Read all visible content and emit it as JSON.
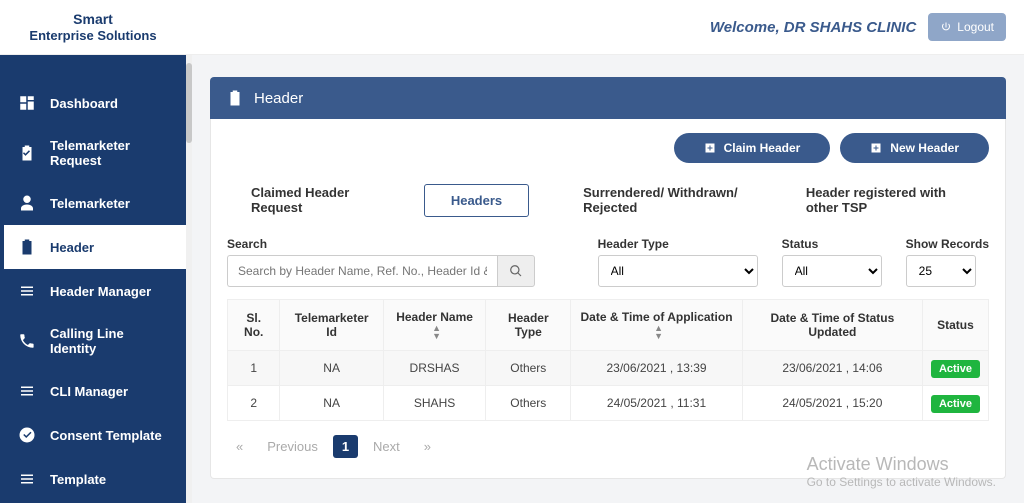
{
  "brand": {
    "line1": "Smart",
    "line2": "Enterprise Solutions"
  },
  "topbar": {
    "welcome": "Welcome, DR SHAHS CLINIC",
    "logout": "Logout"
  },
  "sidebar": {
    "items": [
      {
        "label": "Dashboard"
      },
      {
        "label": "Telemarketer Request"
      },
      {
        "label": "Telemarketer"
      },
      {
        "label": "Header"
      },
      {
        "label": "Header Manager"
      },
      {
        "label": "Calling Line Identity"
      },
      {
        "label": "CLI Manager"
      },
      {
        "label": "Consent Template"
      },
      {
        "label": "Template"
      }
    ]
  },
  "panel": {
    "title": "Header"
  },
  "buttons": {
    "claim": "Claim Header",
    "new": "New Header"
  },
  "tabs": {
    "claimed": "Claimed Header Request",
    "headers": "Headers",
    "surrendered": "Surrendered/ Withdrawn/ Rejected",
    "other": "Header registered with other TSP"
  },
  "filters": {
    "search_label": "Search",
    "search_placeholder": "Search by Header Name, Ref. No., Header Id & TM Id",
    "header_type_label": "Header Type",
    "header_type_value": "All",
    "status_label": "Status",
    "status_value": "All",
    "show_label": "Show Records",
    "show_value": "25"
  },
  "table": {
    "headers": {
      "slno": "Sl. No.",
      "tmid": "Telemarketer Id",
      "hname": "Header Name",
      "htype": "Header Type",
      "dapp": "Date & Time of Application",
      "dupd": "Date & Time of Status Updated",
      "status": "Status"
    },
    "rows": [
      {
        "slno": "1",
        "tmid": "NA",
        "hname": "DRSHAS",
        "htype": "Others",
        "dapp": "23/06/2021 , 13:39",
        "dupd": "23/06/2021 , 14:06",
        "status": "Active"
      },
      {
        "slno": "2",
        "tmid": "NA",
        "hname": "SHAHS",
        "htype": "Others",
        "dapp": "24/05/2021 , 11:31",
        "dupd": "24/05/2021 , 15:20",
        "status": "Active"
      }
    ]
  },
  "pager": {
    "prev": "Previous",
    "page": "1",
    "next": "Next"
  },
  "watermark": {
    "t1": "Activate Windows",
    "t2": "Go to Settings to activate Windows."
  }
}
